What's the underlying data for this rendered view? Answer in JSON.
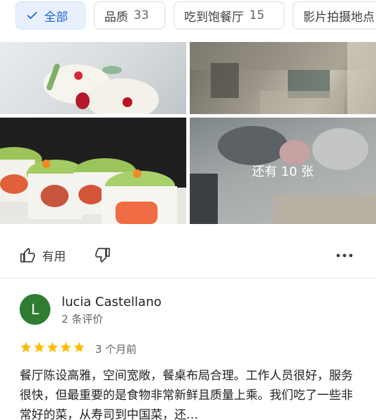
{
  "chips": [
    {
      "label": "全部",
      "count": "",
      "selected": true
    },
    {
      "label": "品质",
      "count": "33",
      "selected": false
    },
    {
      "label": "吃到饱餐厅",
      "count": "15",
      "selected": false
    },
    {
      "label": "影片拍摄地点",
      "count": "",
      "selected": false
    }
  ],
  "photos": {
    "more_label": "还有 10 张"
  },
  "actions": {
    "helpful_label": "有用"
  },
  "review": {
    "avatar_letter": "L",
    "reviewer_name": "lucia Castellano",
    "review_count": "2 条评价",
    "rating": 5,
    "date": "3 个月前",
    "text": "餐厅陈设高雅，空间宽敞，餐桌布局合理。工作人员很好，服务很快，但最重要的是食物非常新鲜且质量上乘。我们吃了一些非常好的菜，从寿司到中国菜，还…"
  },
  "colors": {
    "selected_chip_bg": "#e8f0fe",
    "selected_chip_text": "#1967d2",
    "star": "#fbbc04",
    "avatar_bg": "#2e7d32"
  }
}
